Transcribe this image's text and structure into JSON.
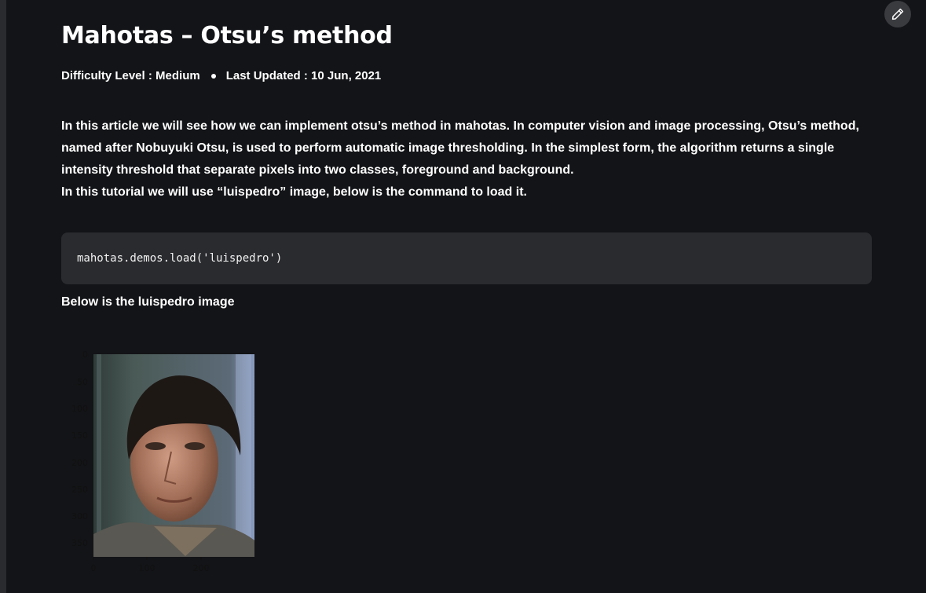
{
  "page": {
    "background": "#131417",
    "edit_icon": "pencil-icon"
  },
  "article": {
    "title": "Mahotas – Otsu’s method",
    "difficulty": "Difficulty Level : Medium",
    "last_updated": "Last Updated : 10 Jun, 2021",
    "paragraph1_line1": "In this article we will see how we can implement otsu’s method in mahotas. In computer vision and image processing, Otsu’s method,",
    "paragraph1_line2": "named after Nobuyuki Otsu, is used to perform automatic image thresholding. In the simplest form, the algorithm returns a single",
    "paragraph1_line3": "intensity threshold that separate pixels into two classes, foreground and background.",
    "paragraph2": "In this tutorial we will use “luispedro” image, below is the command to load it.",
    "code": "mahotas.demos.load('luispedro')",
    "caption": "Below is the luispedro image"
  },
  "figure": {
    "y_ticks": [
      "0",
      "50",
      "100",
      "150",
      "200",
      "250",
      "300",
      "350"
    ],
    "x_ticks": [
      "0",
      "100",
      "200"
    ]
  }
}
